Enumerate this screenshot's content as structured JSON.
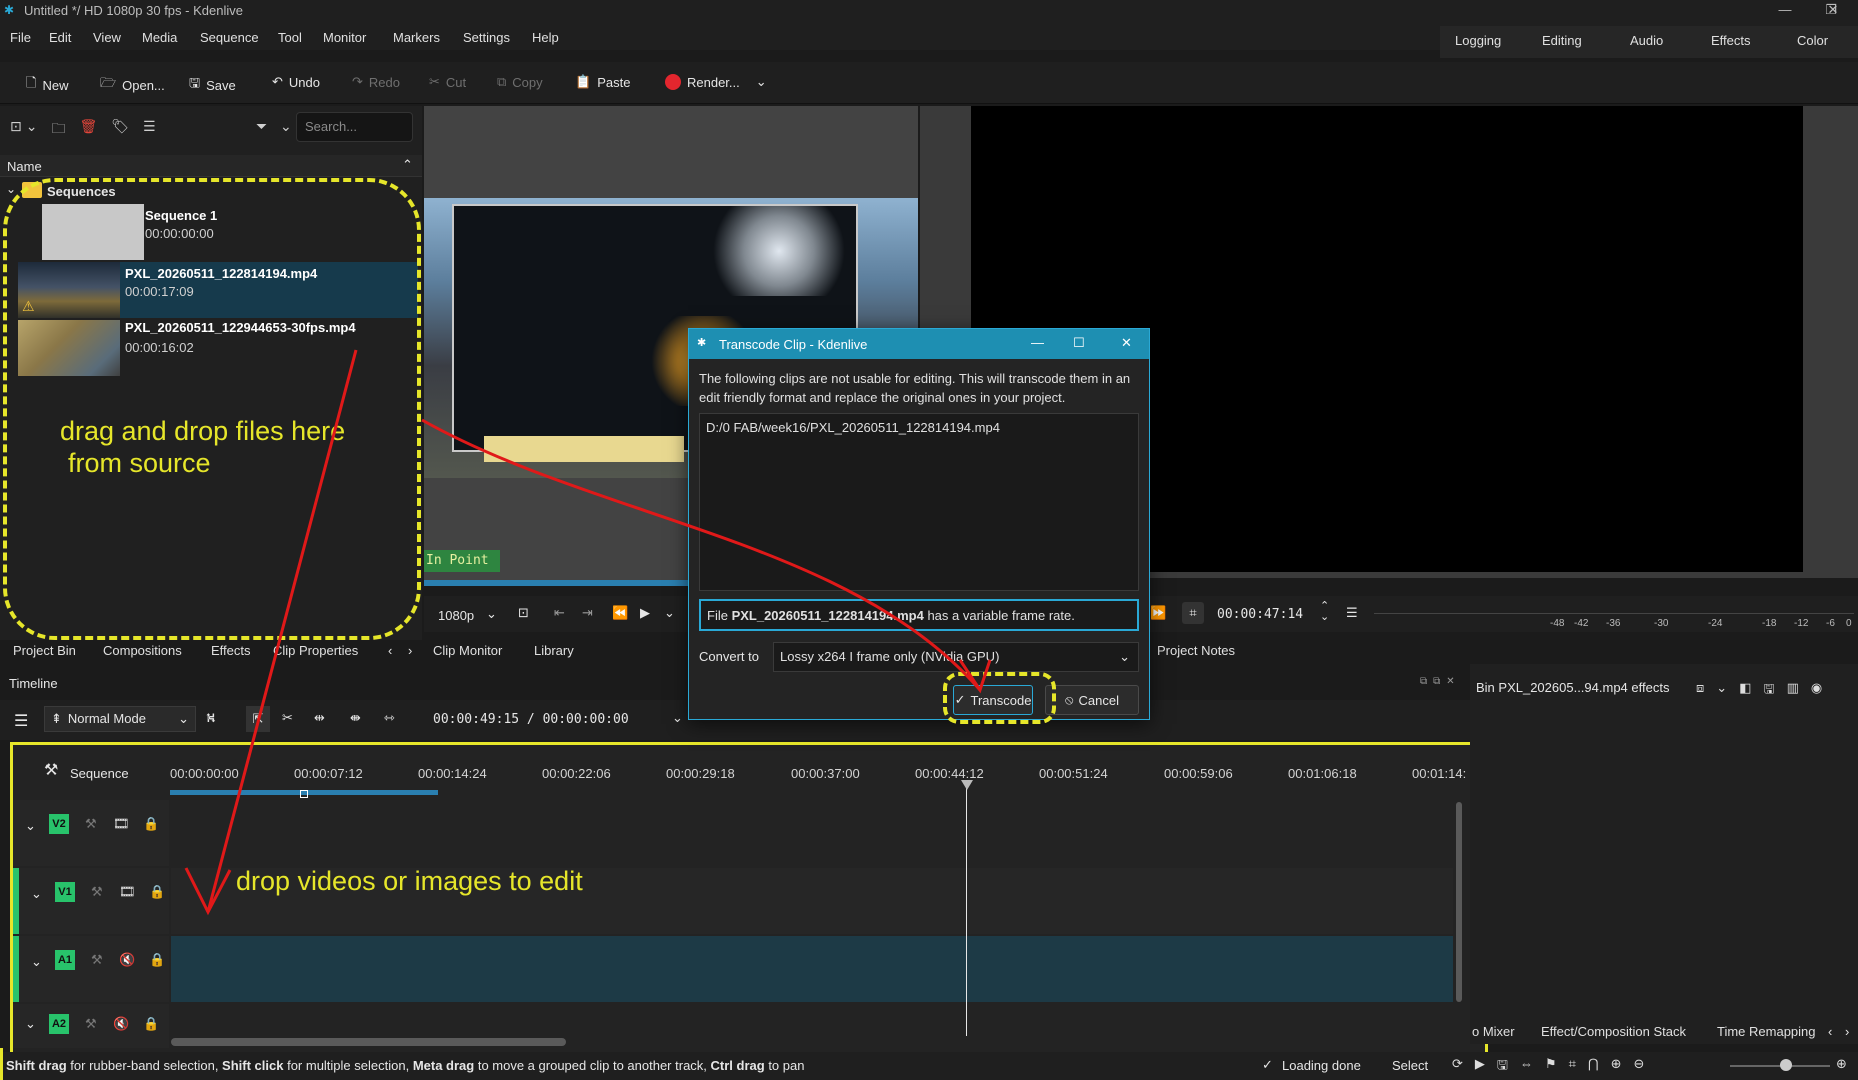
{
  "window": {
    "title": "Untitled */ HD 1080p 30 fps - Kdenlive",
    "minimize": "—",
    "maximize": "❐",
    "close": "✕"
  },
  "menu": [
    "File",
    "Edit",
    "View",
    "Media",
    "Sequence",
    "Tool",
    "Monitor",
    "Markers",
    "Settings",
    "Help"
  ],
  "workspaces": [
    "Logging",
    "Editing",
    "Audio",
    "Effects",
    "Color"
  ],
  "toolbar": {
    "new": "New",
    "open": "Open...",
    "save": "Save",
    "undo": "Undo",
    "redo": "Redo",
    "cut": "Cut",
    "copy": "Copy",
    "paste": "Paste",
    "render": "Render..."
  },
  "bin": {
    "search_placeholder": "Search...",
    "column_name": "Name",
    "folder": "Sequences",
    "clips": [
      {
        "name": "Sequence 1",
        "duration": "00:00:00:00"
      },
      {
        "name": "PXL_20260511_122814194.mp4",
        "duration": "00:00:17:09"
      },
      {
        "name": "PXL_20260511_122944653-30fps.mp4",
        "duration": "00:00:16:02"
      }
    ],
    "annotation_line1": "drag and drop files here",
    "annotation_line2": "from source"
  },
  "dock_tabs_left": [
    "Project Bin",
    "Compositions",
    "Effects",
    "Clip Properties"
  ],
  "clip_monitor": {
    "in_point": "In Point",
    "resolution": "1080p",
    "tabs": [
      "Clip Monitor",
      "Library"
    ]
  },
  "project_monitor": {
    "timecode": "00:00:47:14",
    "audio_scale": [
      "-48",
      "-42",
      "-36",
      "-30",
      "-24",
      "-18",
      "-12",
      "-6",
      "0"
    ],
    "tab": "Project Notes"
  },
  "timeline": {
    "title": "Timeline",
    "mode": "Normal Mode",
    "timecode": "00:00:49:15 / 00:00:00:00",
    "sequence_label": "Sequence",
    "ruler": [
      "00:00:00:00",
      "00:00:07:12",
      "00:00:14:24",
      "00:00:22:06",
      "00:00:29:18",
      "00:00:37:00",
      "00:00:44:12",
      "00:00:51:24",
      "00:00:59:06",
      "00:01:06:18",
      "00:01:14:"
    ],
    "tracks": [
      "V2",
      "V1",
      "A1",
      "A2"
    ],
    "annotation": "drop videos or images to edit"
  },
  "right_panel": {
    "title": "Bin PXL_202605...94.mp4 effects",
    "tabs": [
      "o Mixer",
      "Effect/Composition Stack",
      "Time Remapping"
    ]
  },
  "dialog": {
    "title": "Transcode Clip - Kdenlive",
    "message": "The following clips are not usable for editing. This will transcode them in an edit friendly format and replace the original ones in your project.",
    "file_path": "D:/0 FAB/week16/PXL_20260511_122814194.mp4",
    "warning_prefix": "File ",
    "warning_file": "PXL_20260511_122814194.mp4",
    "warning_suffix": " has a variable frame rate.",
    "convert_label": "Convert to",
    "convert_value": "Lossy x264 I frame only (NVidia GPU)",
    "transcode_button": "Transcode",
    "cancel_button": "Cancel"
  },
  "status": {
    "hint_parts": [
      {
        "b": "Shift drag",
        "t": " for rubber-band selection, "
      },
      {
        "b": "Shift click",
        "t": " for multiple selection, "
      },
      {
        "b": "Meta drag",
        "t": " to move a grouped clip to another track, "
      },
      {
        "b": "Ctrl drag",
        "t": " to pan"
      }
    ],
    "loading": "Loading done",
    "select": "Select"
  },
  "colors": {
    "accent": "#2aa9d6",
    "annotation": "#e6e62a",
    "track_badge": "#28c36b",
    "render_dot": "#e3262e",
    "arrow": "#e01919"
  }
}
